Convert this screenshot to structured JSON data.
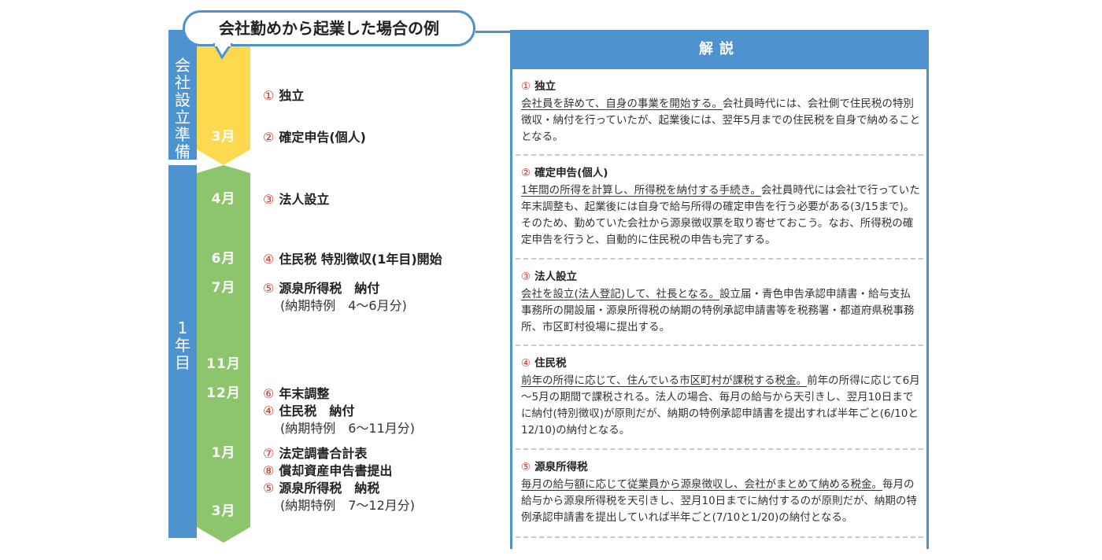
{
  "title": "会社勤めから起業した場合の例",
  "phases": [
    {
      "label": "会社設立準備"
    },
    {
      "label": "1年目"
    }
  ],
  "colors": {
    "blue": "#4e93cf",
    "yellow": "#fcd94f",
    "green": "#8cc56b",
    "red_number": "#d9342b"
  },
  "months": {
    "m3a": "3月",
    "m4": "4月",
    "m6": "6月",
    "m7": "7月",
    "m11": "11月",
    "m12": "12月",
    "m1": "1月",
    "m3b": "3月"
  },
  "events": {
    "e1": {
      "num": "①",
      "text": "独立"
    },
    "e2": {
      "num": "②",
      "text": "確定申告(個人)"
    },
    "e3": {
      "num": "③",
      "text": "法人設立"
    },
    "e4": {
      "num": "④",
      "text": "住民税 特別徴収(1年目)開始"
    },
    "e5": {
      "num": "⑤",
      "text": "源泉所得税　納付",
      "sub": "(納期特例　4～6月分)"
    },
    "e6": {
      "num": "⑥",
      "text": "年末調整"
    },
    "e7": {
      "num": "④",
      "text": "住民税　納付",
      "sub": "(納期特例　6～11月分)"
    },
    "e8": {
      "num": "⑦",
      "text": "法定調書合計表"
    },
    "e9": {
      "num": "⑧",
      "text": "償却資産申告書提出"
    },
    "e10": {
      "num": "⑤",
      "text": "源泉所得税　納税",
      "sub": "(納期特例　7～12月分)"
    }
  },
  "panel": {
    "header": "解説",
    "sections": [
      {
        "num": "①",
        "head": "独立",
        "underlined": "会社員を辞めて、自身の事業を開始する。",
        "body": "会社員時代には、会社側で住民税の特別徴収・納付を行っていたが、起業後には、翌年5月までの住民税を自身で納めることとなる。"
      },
      {
        "num": "②",
        "head": "確定申告(個人)",
        "underlined": "1年間の所得を計算し、所得税を納付する手続き。",
        "body": "会社員時代には会社で行っていた年末調整も、起業後には自身で給与所得の確定申告を行う必要がある(3/15まで)。そのため、勤めていた会社から源泉徴収票を取り寄せておこう。なお、所得税の確定申告を行うと、自動的に住民税の申告も完了する。"
      },
      {
        "num": "③",
        "head": "法人設立",
        "underlined": "会社を設立(法人登記)して、社長となる。",
        "body": "設立届・青色申告承認申請書・給与支払事務所の開設届・源泉所得税の納期の特例承認申請書等を税務署・都道府県税事務所、市区町村役場に提出する。"
      },
      {
        "num": "④",
        "head": "住民税",
        "underlined": "前年の所得に応じて、住んでいる市区町村が課税する税金。",
        "body": "前年の所得に応じて6月～5月の期間で課税される。法人の場合、毎月の給与から天引きし、翌月10日までに納付(特別徴収)が原則だが、納期の特例承認申請書を提出すれば半年ごと(6/10と12/10)の納付となる。"
      },
      {
        "num": "⑤",
        "head": "源泉所得税",
        "underlined": "毎月の給与額に応じて従業員から源泉徴収し、会社がまとめて納める税金。",
        "body": "毎月の給与から源泉所得税を天引きし、翌月10日までに納付するのが原則だが、納期の特例承認申請書を提出していれば半年ごと(7/10と1/20)の納付となる。"
      }
    ]
  }
}
